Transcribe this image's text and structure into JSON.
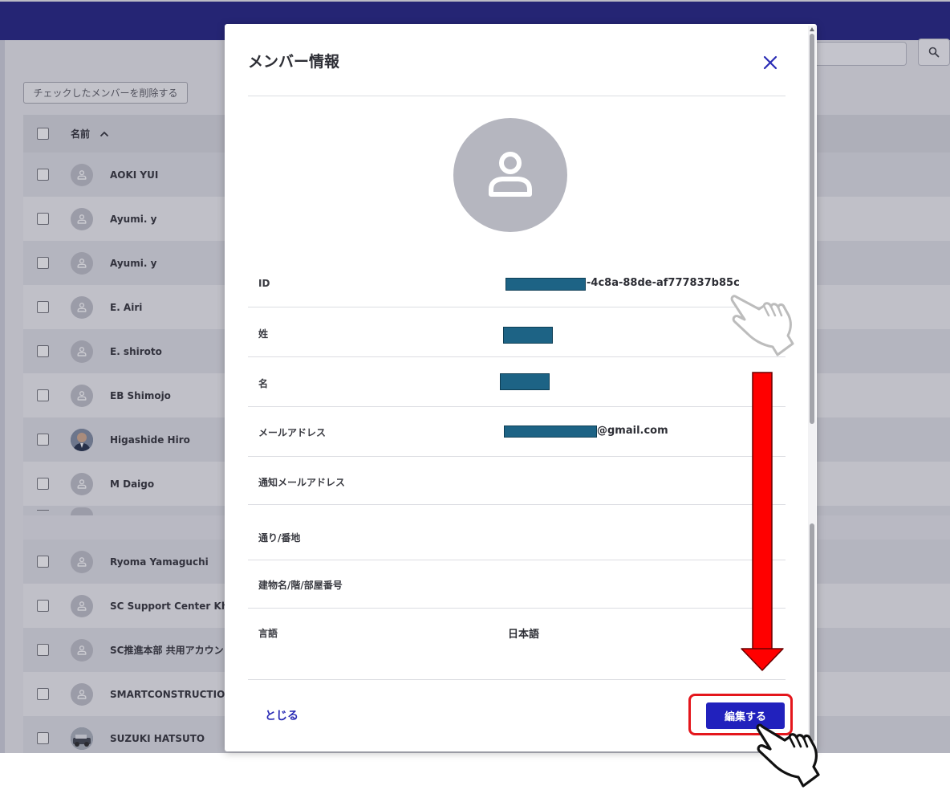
{
  "app": {
    "delete_checked_label": "チェックしたメンバーを削除する",
    "table": {
      "header_name": "名前",
      "rows_top": [
        {
          "name": "AOKI YUI",
          "avatar": "person-icon"
        },
        {
          "name": "Ayumi. y",
          "avatar": "person-icon"
        },
        {
          "name": "Ayumi. y",
          "avatar": "person-icon"
        },
        {
          "name": "E. Airi",
          "avatar": "person-icon"
        },
        {
          "name": "E. shiroto",
          "avatar": "person-icon"
        },
        {
          "name": "EB Shimojo",
          "avatar": "person-icon"
        },
        {
          "name": "Higashide Hiro",
          "avatar": "photo"
        },
        {
          "name": "M Daigo",
          "avatar": "person-icon"
        }
      ],
      "rows_bottom": [
        {
          "name": "Ryoma Yamaguchi",
          "avatar": "person-icon"
        },
        {
          "name": "SC Support Center Khim",
          "avatar": "person-icon"
        },
        {
          "name": "SC推進本部 共用アカウン",
          "avatar": "person-icon"
        },
        {
          "name": "SMARTCONSTRUCTION",
          "avatar": "person-icon"
        },
        {
          "name": "SUZUKI HATSUTO",
          "avatar": "photo"
        }
      ]
    }
  },
  "modal": {
    "title": "メンバー情報",
    "fields": {
      "id": {
        "label": "ID",
        "value": "-4c8a-88de-af777837b85c"
      },
      "last_name": {
        "label": "姓",
        "value": ""
      },
      "first_name": {
        "label": "名",
        "value": ""
      },
      "email": {
        "label": "メールアドレス",
        "value": "@gmail.com"
      },
      "notify_email": {
        "label": "通知メールアドレス",
        "value": ""
      },
      "street": {
        "label": "通り/番地",
        "value": ""
      },
      "building": {
        "label": "建物名/階/部屋番号",
        "value": ""
      },
      "language": {
        "label": "言語",
        "value": "日本語"
      }
    },
    "close_label": "とじる",
    "edit_label": "編集する"
  },
  "colors": {
    "topbar": "#191a7f",
    "primary_button": "#2121bd",
    "link": "#2a2cb5",
    "redaction": "#1d6385",
    "annotation_red": "#e4161c"
  }
}
